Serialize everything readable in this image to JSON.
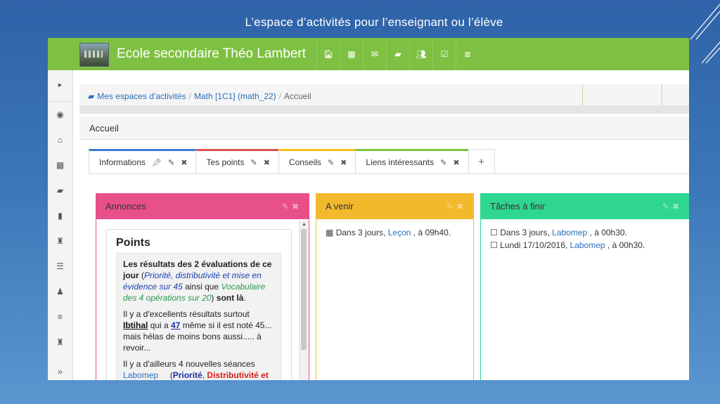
{
  "slide_title": "L’espace d’activités pour  l’enseignant ou l’élève",
  "navbar": {
    "school_name": "Ecole secondaire Théo Lambert",
    "icons": [
      "home-icon",
      "calendar-icon",
      "envelope-icon",
      "folder-icon",
      "users-icon",
      "check-square-icon",
      "database-icon"
    ],
    "icon_glyphs": [
      "🏠︎",
      "▦",
      "✉︎",
      "▰",
      "👥︎",
      "☑︎",
      "≣"
    ]
  },
  "sidebar": {
    "toggle_glyph": "▸",
    "items": [
      {
        "name": "eye-icon",
        "glyph": "◉"
      },
      {
        "name": "home-icon",
        "glyph": "⌂"
      },
      {
        "name": "calendar-icon",
        "glyph": "▦"
      },
      {
        "name": "folder-icon",
        "glyph": "▰"
      },
      {
        "name": "bar-chart-icon",
        "glyph": "▮"
      },
      {
        "name": "trophy-icon",
        "glyph": "♜"
      },
      {
        "name": "list-icon",
        "glyph": "☰"
      },
      {
        "name": "users-icon",
        "glyph": "♟"
      },
      {
        "name": "list-icon",
        "glyph": "≡"
      },
      {
        "name": "trophy-icon",
        "glyph": "♜"
      }
    ],
    "collapse_glyph": "»"
  },
  "breadcrumb": {
    "items": [
      "Mes espaces d'activités",
      "Math [1C1] (math_22)",
      "Accueil"
    ],
    "separator": "/"
  },
  "page_header": "Accueil",
  "tabs": [
    {
      "label": "Informations",
      "color": "#3a7bd5",
      "icons": [
        "📌︎",
        "✎",
        "✖"
      ]
    },
    {
      "label": "Tes points",
      "color": "#d9534f",
      "icons": [
        "✎",
        "✖"
      ]
    },
    {
      "label": "Conseils",
      "color": "#f0c419",
      "icons": [
        "✎",
        "✖"
      ]
    },
    {
      "label": "Liens intéressants",
      "color": "#7ec142",
      "icons": [
        "✎",
        "✖"
      ]
    }
  ],
  "tab_add": "+",
  "panels": {
    "annonces": {
      "title": "Annonces",
      "head_bg": "#e8508a",
      "border": "#e8508a",
      "actions": "✎✖",
      "card_title": "Points",
      "p1": {
        "a": "Les résultats des 2 évaluations de ce jour",
        "b": " (",
        "c": "Priorité, distributivité et mise en évidence sur 45",
        "d": " ainsi que ",
        "e": "Vocabulaire des 4 opérations sur 20",
        "f": ") ",
        "g": "sont là",
        "h": "."
      },
      "p2": {
        "a": "Il y a d'excellents résultats surtout ",
        "b": "Ibtihal",
        "c": " qui a ",
        "d": "47",
        "e": " même si il est noté 45... mais hélas de moins bons aussi..... à revoir..."
      },
      "p3": {
        "a": "Il y a d'ailleurs 4 nouvelles séances ",
        "b": "Labomep",
        "c": "     (",
        "d": "Priorité",
        "e": ", ",
        "f": "Distributivité et"
      }
    },
    "a_venir": {
      "title": "A venir",
      "head_bg": "#f2b92c",
      "border": "#f2b92c",
      "actions": "✎✖",
      "events": [
        {
          "prefix": "Dans 3 jours, ",
          "link": "Leçon",
          "suffix": " , à 09h40."
        }
      ]
    },
    "taches": {
      "title": "Tâches à finir",
      "head_bg": "#2fd68f",
      "border": "#2fd68f",
      "actions": "✎✖",
      "tasks": [
        {
          "prefix": "Dans 3 jours, ",
          "link": "Labomep",
          "suffix": " , à 00h30."
        },
        {
          "prefix": "Lundi 17/10/2016, ",
          "link": "Labomep",
          "suffix": " , à 00h30."
        }
      ]
    }
  }
}
